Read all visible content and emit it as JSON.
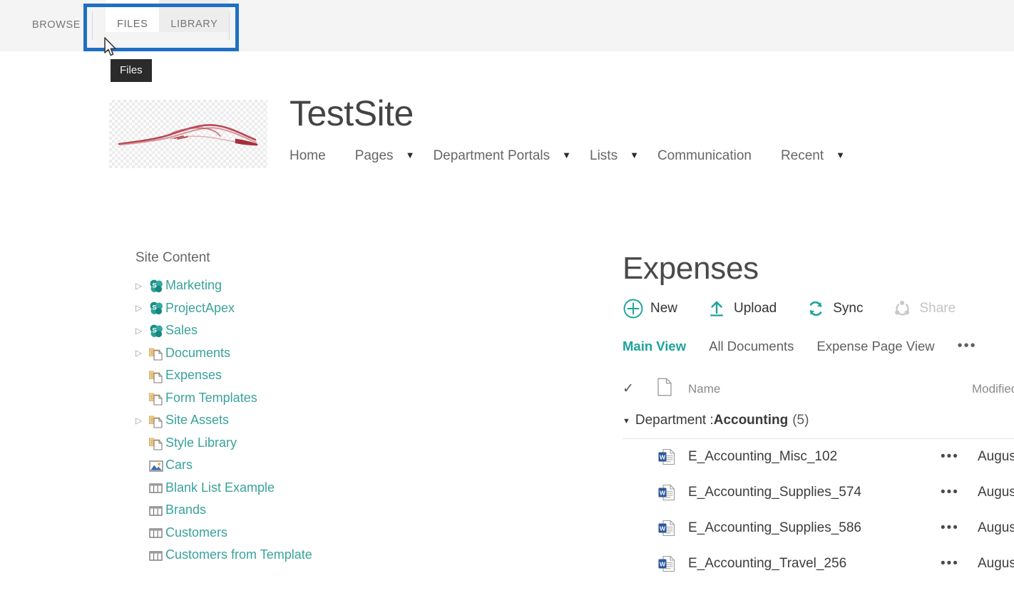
{
  "ribbon": {
    "tabs": [
      {
        "label": "BROWSE",
        "state": "normal"
      },
      {
        "label": "FILES",
        "state": "active"
      },
      {
        "label": "LIBRARY",
        "state": "inactive"
      }
    ],
    "tooltip": "Files",
    "highlight_color": "#1f6fc4",
    "bar_background": "#f4f4f4"
  },
  "site": {
    "title": "TestSite",
    "logo_icon": "car-sketch-logo",
    "nav": [
      {
        "label": "Home",
        "caret": false
      },
      {
        "label": "Pages",
        "caret": true
      },
      {
        "label": "Department Portals",
        "caret": true
      },
      {
        "label": "Lists",
        "caret": true
      },
      {
        "label": "Communication",
        "caret": false
      },
      {
        "label": "Recent",
        "caret": true
      }
    ]
  },
  "sidebar": {
    "title": "Site Content",
    "items": [
      {
        "label": "Marketing",
        "icon": "sharepoint-site-icon",
        "expandable": true
      },
      {
        "label": "ProjectApex",
        "icon": "sharepoint-site-icon",
        "expandable": true
      },
      {
        "label": "Sales",
        "icon": "sharepoint-site-icon",
        "expandable": true
      },
      {
        "label": "Documents",
        "icon": "document-library-icon",
        "expandable": true
      },
      {
        "label": "Expenses",
        "icon": "document-library-icon",
        "expandable": false
      },
      {
        "label": "Form Templates",
        "icon": "document-library-icon",
        "expandable": false
      },
      {
        "label": "Site Assets",
        "icon": "document-library-icon",
        "expandable": true
      },
      {
        "label": "Style Library",
        "icon": "document-library-icon",
        "expandable": false
      },
      {
        "label": "Cars",
        "icon": "picture-library-icon",
        "expandable": false
      },
      {
        "label": "Blank List Example",
        "icon": "list-icon",
        "expandable": false
      },
      {
        "label": "Brands",
        "icon": "list-icon",
        "expandable": false
      },
      {
        "label": "Customers",
        "icon": "list-icon",
        "expandable": false
      },
      {
        "label": "Customers from Template",
        "icon": "list-icon",
        "expandable": false
      }
    ]
  },
  "main": {
    "title": "Expenses",
    "commands": [
      {
        "label": "New",
        "icon": "plus-circle-icon",
        "disabled": false
      },
      {
        "label": "Upload",
        "icon": "upload-arrow-icon",
        "disabled": false
      },
      {
        "label": "Sync",
        "icon": "sync-icon",
        "disabled": false
      },
      {
        "label": "Share",
        "icon": "share-icon",
        "disabled": true
      }
    ],
    "views": [
      {
        "label": "Main View",
        "active": true
      },
      {
        "label": "All Documents",
        "active": false
      },
      {
        "label": "Expense Page View",
        "active": false
      },
      {
        "label": "•••",
        "active": false
      }
    ],
    "columns": {
      "check": "✓",
      "doc_icon": "document-icon",
      "name": "Name",
      "modified": "Modified"
    },
    "group": {
      "prefix": "Department : ",
      "value": "Accounting",
      "count": "(5)",
      "expanded": true
    },
    "rows": [
      {
        "name": "E_Accounting_Misc_102",
        "icon": "word-document-icon",
        "menu": "•••",
        "modified": "August"
      },
      {
        "name": "E_Accounting_Supplies_574",
        "icon": "word-document-icon",
        "menu": "•••",
        "modified": "August"
      },
      {
        "name": "E_Accounting_Supplies_586",
        "icon": "word-document-icon",
        "menu": "•••",
        "modified": "August"
      },
      {
        "name": "E_Accounting_Travel_256",
        "icon": "word-document-icon",
        "menu": "•••",
        "modified": "August"
      }
    ]
  },
  "theme": {
    "accent_teal": "#1ca39a",
    "link_teal": "#39a39b",
    "highlight_blue": "#1f6fc4",
    "tooltip_bg": "#2b2b2b"
  }
}
